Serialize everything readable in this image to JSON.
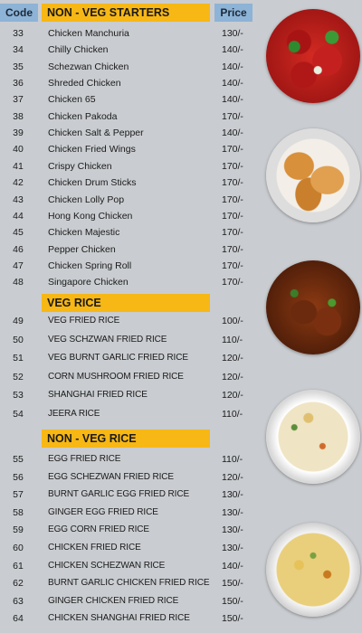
{
  "header": {
    "code": "Code",
    "price": "Price"
  },
  "sections": {
    "nonveg_starters": {
      "title": "NON - VEG STARTERS",
      "items": [
        {
          "code": "33",
          "name": "Chicken Manchuria",
          "price": "130/-"
        },
        {
          "code": "34",
          "name": "Chilly Chicken",
          "price": "140/-"
        },
        {
          "code": "35",
          "name": "Schezwan Chicken",
          "price": "140/-"
        },
        {
          "code": "36",
          "name": "Shreded Chicken",
          "price": "140/-"
        },
        {
          "code": "37",
          "name": "Chicken 65",
          "price": "140/-"
        },
        {
          "code": "38",
          "name": "Chicken Pakoda",
          "price": "170/-"
        },
        {
          "code": "39",
          "name": "Chicken Salt & Pepper",
          "price": "140/-"
        },
        {
          "code": "40",
          "name": "Chicken Fried Wings",
          "price": "170/-"
        },
        {
          "code": "41",
          "name": "Crispy Chicken",
          "price": "170/-"
        },
        {
          "code": "42",
          "name": "Chicken Drum Sticks",
          "price": "170/-"
        },
        {
          "code": "43",
          "name": "Chicken Lolly Pop",
          "price": "170/-"
        },
        {
          "code": "44",
          "name": "Hong Kong Chicken",
          "price": "170/-"
        },
        {
          "code": "45",
          "name": "Chicken Majestic",
          "price": "170/-"
        },
        {
          "code": "46",
          "name": "Pepper Chicken",
          "price": "170/-"
        },
        {
          "code": "47",
          "name": "Chicken Spring Roll",
          "price": "170/-"
        },
        {
          "code": "48",
          "name": "Singapore Chicken",
          "price": "170/-"
        }
      ]
    },
    "veg_rice": {
      "title": "VEG RICE",
      "items": [
        {
          "code": "49",
          "name": "VEG FRIED RICE",
          "price": "100/-"
        },
        {
          "code": "50",
          "name": "VEG SCHZWAN FRIED RICE",
          "price": "110/-"
        },
        {
          "code": "51",
          "name": "VEG BURNT GARLIC FRIED RICE",
          "price": "120/-"
        },
        {
          "code": "52",
          "name": " CORN MUSHROOM FRIED RICE",
          "price": "120/-"
        },
        {
          "code": "53",
          "name": "SHANGHAI FRIED RICE",
          "price": "120/-"
        },
        {
          "code": "54",
          "name": "JEERA RICE",
          "price": "110/-"
        }
      ]
    },
    "nonveg_rice": {
      "title": "NON - VEG RICE",
      "items": [
        {
          "code": "55",
          "name": "EGG FRIED RICE",
          "price": "110/-"
        },
        {
          "code": "56",
          "name": "EGG SCHEZWAN FRIED RICE",
          "price": "120/-"
        },
        {
          "code": "57",
          "name": "BURNT GARLIC EGG FRIED RICE",
          "price": "130/-"
        },
        {
          "code": "58",
          "name": "GINGER EGG FRIED RICE",
          "price": "130/-"
        },
        {
          "code": "59",
          "name": "EGG CORN FRIED RICE",
          "price": "130/-"
        },
        {
          "code": "60",
          "name": "CHICKEN FRIED RICE",
          "price": "130/-"
        },
        {
          "code": "61",
          "name": "CHICKEN SCHEZWAN RICE",
          "price": "140/-"
        },
        {
          "code": "62",
          "name": "BURNT GARLIC CHICKEN FRIED RICE",
          "price": "150/-"
        },
        {
          "code": "63",
          "name": "GINGER CHICKEN FRIED RICE",
          "price": "150/-"
        },
        {
          "code": "64",
          "name": "CHICKEN SHANGHAI FRIED RICE",
          "price": "150/-"
        }
      ]
    }
  },
  "colors": {
    "background": "#c9ccd0",
    "section_bar": "#f7b715",
    "header_blue": "#8db3d6"
  }
}
